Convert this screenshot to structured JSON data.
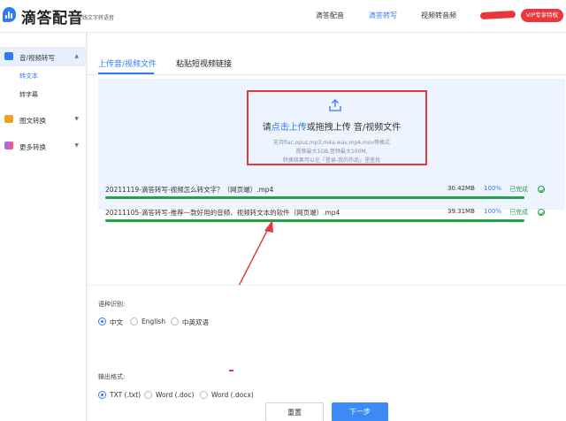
{
  "header": {
    "logo_text": "滴答配音",
    "logo_sub": "在线文字转语音",
    "nav": [
      "滴答配音",
      "滴答转写",
      "视频转音频"
    ],
    "nav_active_index": 1,
    "vip_label": "VIP专享特权"
  },
  "sidebar": {
    "groups": [
      {
        "label": "音/视频转写",
        "icon": "audio-video-icon",
        "expanded": true,
        "active": true
      },
      {
        "label": "图文转换",
        "icon": "image-text-icon",
        "expanded": false
      },
      {
        "label": "更多转换",
        "icon": "grid-icon",
        "expanded": false
      }
    ],
    "sub_items": [
      {
        "label": "转文本",
        "active": true
      },
      {
        "label": "转字幕",
        "active": false
      }
    ]
  },
  "tabs": [
    "上传音/视频文件",
    "粘贴短视频链接"
  ],
  "upload": {
    "prefix": "请",
    "link": "点击上传",
    "suffix": "或拖拽上传 音/视频文件",
    "hints": [
      "支持flac,opus,mp3,m4a,wav,mp4,mov等格式",
      "视频最大1GB,音频最大100M,",
      "转换结果可以在「登录-我的作品」里查找"
    ]
  },
  "files": [
    {
      "name": "20211119-滴答转写-视频怎么转文字？（网页端）.mp4",
      "size": "30.42MB",
      "percent": "100%",
      "status": "已完成",
      "progress": 1.0
    },
    {
      "name": "20211105-滴答转写-推荐一款好用的音频、视频转文本的软件（网页端）.mp4",
      "size": "39.31MB",
      "percent": "100%",
      "status": "已完成",
      "progress": 1.0
    }
  ],
  "language": {
    "title": "语种识别:",
    "options": [
      "中文",
      "English",
      "中英双语"
    ],
    "selected": 0
  },
  "format": {
    "title": "输出格式:",
    "options": [
      "TXT (.txt)",
      "Word (.doc)",
      "Word (.docx)"
    ],
    "selected": 0
  },
  "buttons": {
    "reset": "重置",
    "next": "下一步"
  },
  "colors": {
    "accent": "#2f7bf5",
    "success": "#22a04a",
    "danger": "#e23a3a"
  }
}
